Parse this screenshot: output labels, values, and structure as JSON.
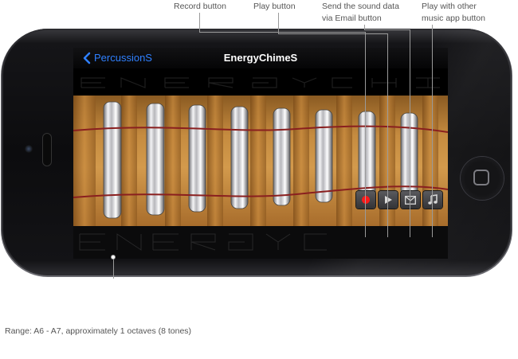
{
  "callouts": {
    "record": "Record button",
    "play": "Play button",
    "email_line1": "Send the sound data",
    "email_line2": "via Email button",
    "music_line1": "Play with other",
    "music_line2": "music app button"
  },
  "nav": {
    "back_label": "PercussionS",
    "title": "EnergyChimeS"
  },
  "chimes": [
    "chime-1",
    "chime-2",
    "chime-3",
    "chime-4",
    "chime-5",
    "chime-6",
    "chime-7",
    "chime-8"
  ],
  "icons": {
    "record": "record-icon",
    "play": "play-icon",
    "email": "email-icon",
    "music": "music-note-icon"
  },
  "colors": {
    "accent": "#2f80ff",
    "record": "#ff1a1a",
    "wood": "#c58b3f",
    "string": "#8a1f1f"
  },
  "footer": {
    "range": "Range: A6 - A7, approximately 1 octaves (8 tones)"
  }
}
